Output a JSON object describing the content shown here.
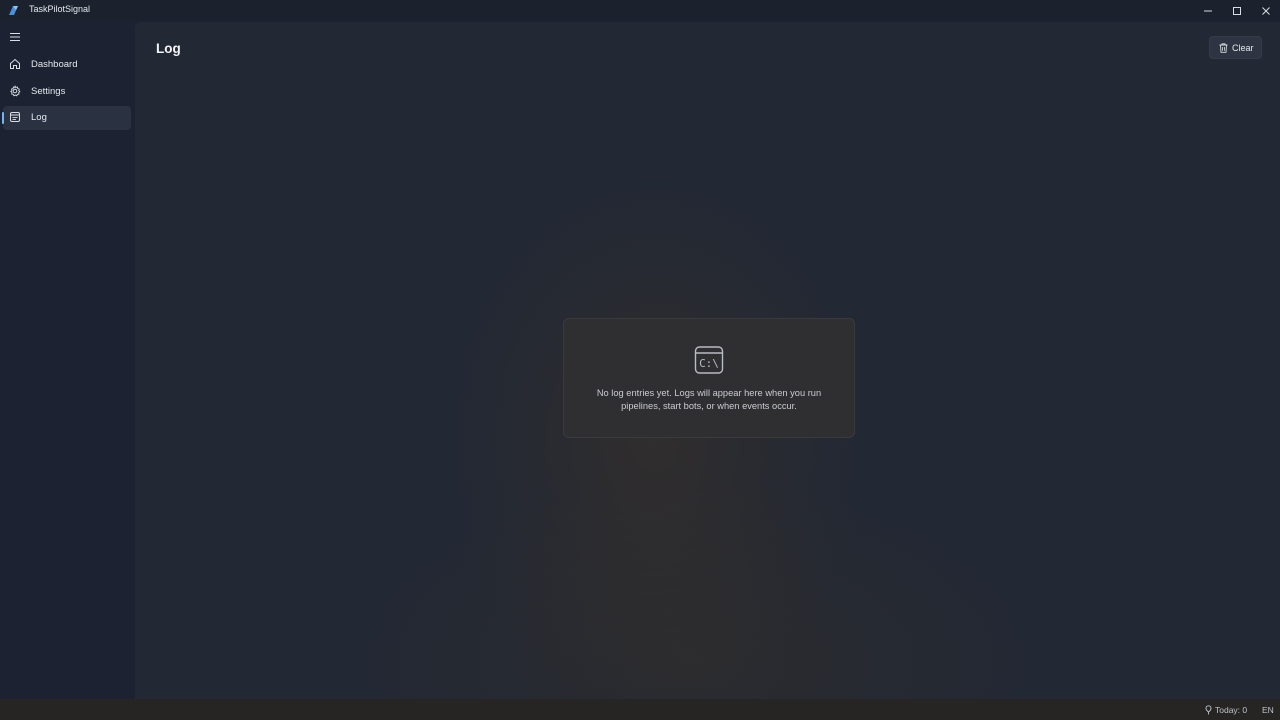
{
  "window": {
    "title": "TaskPilotSignal",
    "controls": [
      "minimize",
      "maximize",
      "close"
    ]
  },
  "sidebar": {
    "menu_icon": "hamburger-icon",
    "items": [
      {
        "label": "Dashboard",
        "icon": "home-icon",
        "active": false
      },
      {
        "label": "Settings",
        "icon": "gear-icon",
        "active": false
      },
      {
        "label": "Log",
        "icon": "log-icon",
        "active": true
      }
    ]
  },
  "main": {
    "title": "Log",
    "clear_button": {
      "label": "Clear",
      "icon": "trash-icon"
    },
    "empty_state": {
      "icon": "terminal-icon",
      "message": "No log entries yet. Logs will appear here when you run pipelines, start bots, or when events occur."
    }
  },
  "statusbar": {
    "today_label": "Today: 0",
    "today_icon": "pin-icon",
    "language": "EN"
  },
  "colors": {
    "accent": "#6fb6f2",
    "background": "#1c2230",
    "card": "#2f2f31"
  }
}
